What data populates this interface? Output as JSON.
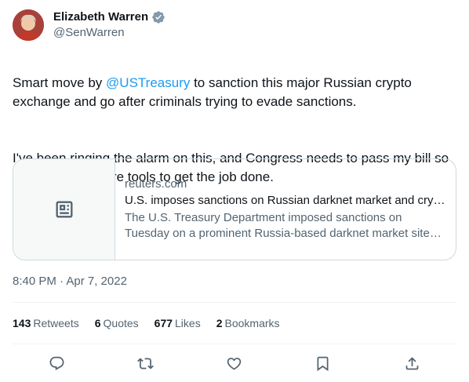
{
  "author": {
    "name": "Elizabeth Warren",
    "handle": "@SenWarren"
  },
  "tweet": {
    "text_part1": "Smart move by ",
    "mention": "@USTreasury",
    "text_part2": " to sanction this major Russian crypto exchange and go after criminals trying to evade sanctions.",
    "text_para2": "I've been ringing the alarm on this, and Congress needs to pass my bill so Treasury has more tools to get the job done."
  },
  "card": {
    "domain": "reuters.com",
    "title": "U.S. imposes sanctions on Russian darknet market and crypto exchange",
    "description": "The U.S. Treasury Department imposed sanctions on Tuesday on a prominent Russia-based darknet market site and a cryptocurrency exchange"
  },
  "timestamp": "8:40 PM · Apr 7, 2022",
  "stats": [
    {
      "value": "143",
      "label": "Retweets"
    },
    {
      "value": "6",
      "label": "Quotes"
    },
    {
      "value": "677",
      "label": "Likes"
    },
    {
      "value": "2",
      "label": "Bookmarks"
    }
  ],
  "icons": {
    "verified": "verified-badge-icon",
    "card_thumb": "article-icon",
    "reply": "reply-icon",
    "retweet": "retweet-icon",
    "like": "like-icon",
    "bookmark": "bookmark-icon",
    "share": "share-icon"
  },
  "colors": {
    "accent": "#1d9bf0",
    "text": "#0f1419",
    "secondary": "#536471",
    "border": "#cfd9de"
  }
}
